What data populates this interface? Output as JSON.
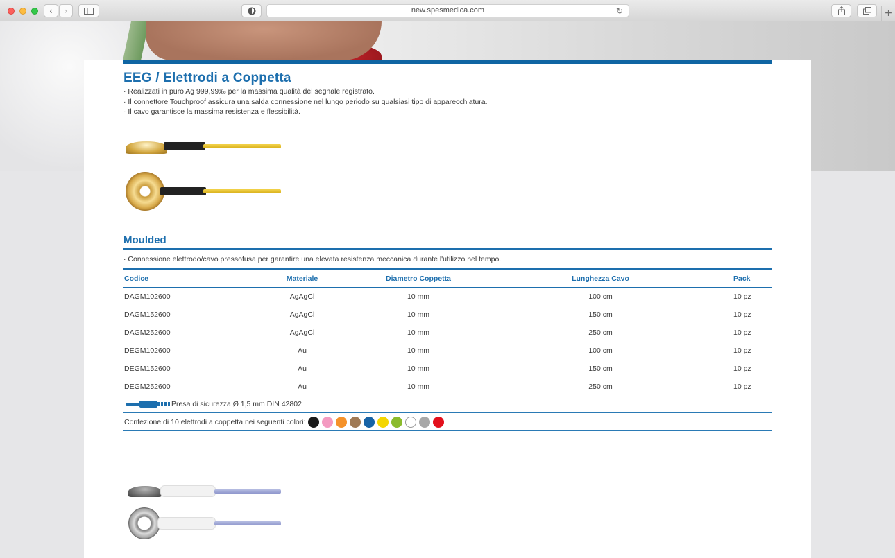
{
  "browser": {
    "url": "new.spesmedica.com",
    "back_icon": "chevron-left-icon",
    "forward_icon": "chevron-right-icon",
    "sidebar_icon": "sidebar-icon",
    "privacy_icon": "shield-icon",
    "reload_icon": "reload-icon",
    "share_icon": "share-icon",
    "tabs_icon": "tabs-icon",
    "new_tab": "+"
  },
  "product": {
    "title": "EEG / Elettrodi a Coppetta",
    "bullets": [
      "· Realizzati in puro Ag 999,99‰ per la massima qualità del segnale registrato.",
      "· Il connettore Touchproof assicura una salda connessione nel lungo periodo su qualsiasi tipo di apparecchiatura.",
      "· Il cavo garantisce la massima resistenza e flessibilità."
    ]
  },
  "moulded": {
    "title": "Moulded",
    "description": "· Connessione elettrodo/cavo pressofusa per garantire una elevata resistenza meccanica durante l'utilizzo nel tempo.",
    "headers": [
      "Codice",
      "Materiale",
      "Diametro Coppetta",
      "Lunghezza Cavo",
      "Pack"
    ],
    "rows": [
      [
        "DAGM102600",
        "AgAgCl",
        "10 mm",
        "100 cm",
        "10 pz"
      ],
      [
        "DAGM152600",
        "AgAgCl",
        "10 mm",
        "150 cm",
        "10 pz"
      ],
      [
        "DAGM252600",
        "AgAgCl",
        "10 mm",
        "250 cm",
        "10 pz"
      ],
      [
        "DEGM102600",
        "Au",
        "10 mm",
        "100 cm",
        "10 pz"
      ],
      [
        "DEGM152600",
        "Au",
        "10 mm",
        "150 cm",
        "10 pz"
      ],
      [
        "DEGM252600",
        "Au",
        "10 mm",
        "250 cm",
        "10 pz"
      ]
    ],
    "connector_note": "Presa di sicurezza Ø 1,5 mm DIN 42802",
    "colors_label": "Confezione di 10 elettrodi a coppetta nei seguenti colori:",
    "colors": [
      "#1a1a1a",
      "#f49ac1",
      "#f5922a",
      "#a07a55",
      "#1763a6",
      "#f4d600",
      "#8bbb2c",
      "#ffffff",
      "#a8a8a8",
      "#e3101c"
    ]
  }
}
